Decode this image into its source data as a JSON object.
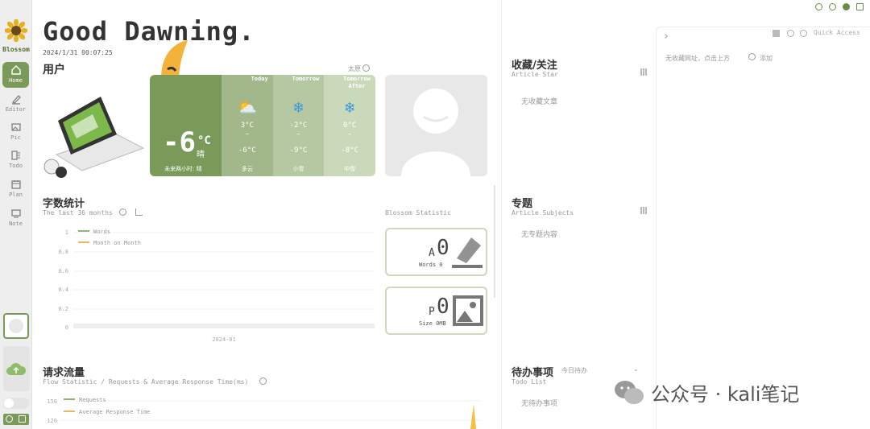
{
  "app": {
    "logo_label": "Blossom"
  },
  "sidebar": {
    "items": [
      {
        "label": "Home",
        "icon": "home-icon"
      },
      {
        "label": "Editor",
        "icon": "editor-icon"
      },
      {
        "label": "Pic",
        "icon": "picture-icon"
      },
      {
        "label": "Todo",
        "icon": "todo-icon"
      },
      {
        "label": "Plan",
        "icon": "calendar-icon"
      },
      {
        "label": "Note",
        "icon": "note-icon"
      }
    ]
  },
  "header": {
    "greeting": "Good Dawning.",
    "datetime": "2024/1/31 00:07:25",
    "user_label": "用户"
  },
  "weather": {
    "location": "太原",
    "temperature": "-6",
    "unit": "°C",
    "condition": "晴",
    "forecast_note": "未来两小时: 晴",
    "days": [
      {
        "day": "Today",
        "high": "3°C",
        "low": "-6°C",
        "condition": "多云",
        "icon": "⛅"
      },
      {
        "day": "Tomorrow",
        "high": "-2°C",
        "low": "-9°C",
        "condition": "小雪",
        "icon": "❄"
      },
      {
        "day": "Tomorrow After",
        "high": "0°C",
        "low": "-8°C",
        "condition": "中雪",
        "icon": "❄"
      }
    ],
    "separator": "~"
  },
  "word_stats": {
    "title": "字数统计",
    "subtitle": "The last 36 months",
    "legend": [
      "Words",
      "Month on Month"
    ],
    "y_ticks": [
      "1",
      "0.8",
      "0.6",
      "0.4",
      "0.2",
      "0"
    ],
    "x_tick": "2024-01"
  },
  "blossom_stats": {
    "title": "Blossom Statistic",
    "cards": [
      {
        "prefix": "A",
        "value": "0",
        "label": "Words 0"
      },
      {
        "prefix": "P",
        "value": "0",
        "label": "Size 0MB"
      }
    ]
  },
  "traffic": {
    "title": "请求流量",
    "subtitle": "Flow Statistic / Requests & Average Response Time(ms)",
    "legend": [
      "Requests",
      "Average Response Time"
    ],
    "y_ticks": [
      "150",
      "120"
    ]
  },
  "starred": {
    "title": "收藏/关注",
    "subtitle": "Article Star",
    "empty": "无收藏文章"
  },
  "subjects": {
    "title": "专题",
    "subtitle": "Article Subjects",
    "empty": "无专题内容"
  },
  "todo": {
    "title": "待办事项",
    "subtitle": "Todo List",
    "filter": "今日待办",
    "empty": "无待办事项"
  },
  "quick_access": {
    "label": "Quick Access",
    "empty": "无收藏网址，点击上方",
    "add": "添加"
  },
  "watermark": {
    "text": "公众号 · kali笔记"
  },
  "colors": {
    "accent": "#7a9a5a",
    "accent_light": "#cfd9bd",
    "legend_green": "#6a9a4a",
    "legend_orange": "#e0a030"
  }
}
